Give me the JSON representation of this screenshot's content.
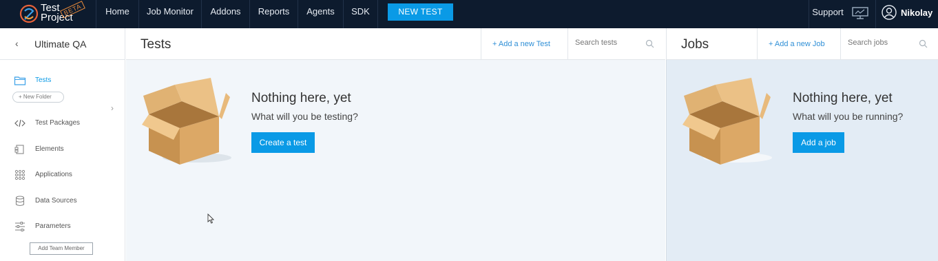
{
  "app": {
    "logo_text_1": "Test",
    "logo_text_2": "Project",
    "logo_badge": "BETA"
  },
  "nav": {
    "items": [
      "Home",
      "Job Monitor",
      "Addons",
      "Reports",
      "Agents",
      "SDK"
    ],
    "new_test_label": "NEW TEST",
    "support_label": "Support",
    "user_name": "Nikolay"
  },
  "sidebar": {
    "project_title": "Ultimate QA",
    "items": [
      {
        "label": "Tests",
        "icon": "folder-icon"
      },
      {
        "label": "Test Packages",
        "icon": "code-icon"
      },
      {
        "label": "Elements",
        "icon": "elements-icon"
      },
      {
        "label": "Applications",
        "icon": "grid-icon"
      },
      {
        "label": "Data Sources",
        "icon": "database-icon"
      },
      {
        "label": "Parameters",
        "icon": "sliders-icon"
      }
    ],
    "new_folder_label": "+ New Folder",
    "add_team_member_label": "Add Team Member"
  },
  "tests_panel": {
    "title": "Tests",
    "add_label": "+  Add a new Test",
    "search_placeholder": "Search tests",
    "empty_title": "Nothing here, yet",
    "empty_subtitle": "What will you be testing?",
    "cta_label": "Create a test"
  },
  "jobs_panel": {
    "title": "Jobs",
    "add_label": "+  Add a new Job",
    "search_placeholder": "Search jobs",
    "empty_title": "Nothing here, yet",
    "empty_subtitle": "What will you be running?",
    "cta_label": "Add a job"
  },
  "colors": {
    "topbar": "#0d1b2e",
    "accent": "#0a9ae6",
    "tests_bg": "#f2f6fa",
    "jobs_bg": "#e3ecf5"
  }
}
